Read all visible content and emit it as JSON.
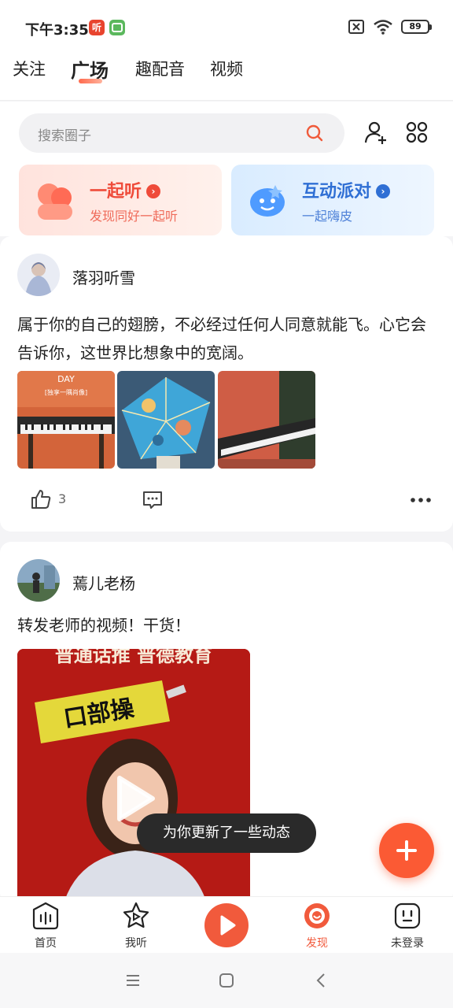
{
  "status_bar": {
    "time": "下午3:35",
    "app_icon_1": "听",
    "battery": "89"
  },
  "top_tabs": [
    {
      "label": "关注",
      "active": false
    },
    {
      "label": "广场",
      "active": true
    },
    {
      "label": "趣配音",
      "active": false
    },
    {
      "label": "视频",
      "active": false
    }
  ],
  "search": {
    "placeholder": "搜索圈子"
  },
  "banners": {
    "listen": {
      "title": "一起听",
      "subtitle": "发现同好一起听",
      "color": "#ef4b3a"
    },
    "party": {
      "title": "互动派对",
      "subtitle": "一起嗨皮",
      "color": "#2f6fd4"
    }
  },
  "posts": [
    {
      "username": "落羽听雪",
      "text": "属于你的自己的翅膀，不必经过任何人同意就能飞。心它会告诉你，这世界比想象中的宽阔。",
      "thumb_1_text": {
        "line1": "DAY",
        "line2": "[独享一隅肖像]"
      },
      "like_count": "3"
    },
    {
      "username": "蔫儿老杨",
      "text": "转发老师的视频！干货！",
      "video_banner": "口部操",
      "video_header": "普通话推 普德教育"
    }
  ],
  "toast": "为你更新了一些动态",
  "bottom_nav": [
    {
      "label": "首页"
    },
    {
      "label": "我听"
    },
    {
      "label": "发现",
      "active": true,
      "active_color": "#f15a3c"
    },
    {
      "label": "未登录"
    }
  ]
}
